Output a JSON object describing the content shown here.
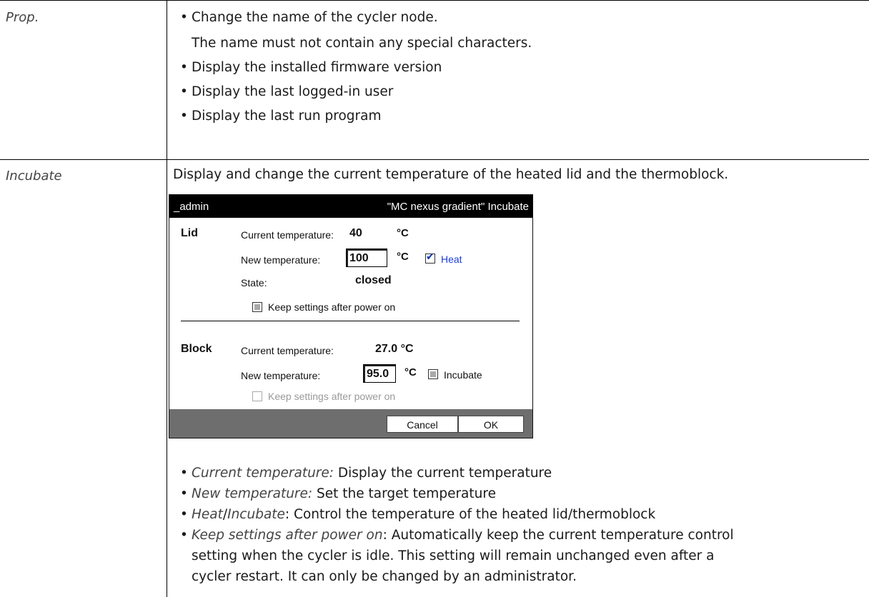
{
  "rows": [
    {
      "label": "Prop.",
      "bullets": [
        {
          "text": "Change the name of the cycler node.",
          "sub": "The name must not contain any special characters."
        },
        {
          "text": "Display the installed firmware version"
        },
        {
          "text": "Display the last logged-in user"
        },
        {
          "text": "Display the last run program"
        }
      ]
    },
    {
      "label": "Incubate",
      "intro": "Display and change the current temperature of the heated lid and the thermoblock."
    }
  ],
  "dialog": {
    "title_left": "_admin",
    "title_right": "\"MC nexus gradient\" Incubate",
    "lid": {
      "title": "Lid",
      "current_label": "Current temperature:",
      "current_value": "40",
      "unit": "°C",
      "new_label": "New temperature:",
      "new_value": "100",
      "heat_label": "Heat",
      "heat_checked": true,
      "state_label": "State:",
      "state_value": "closed",
      "keep_label": "Keep settings after power on",
      "keep_checked": false
    },
    "block": {
      "title": "Block",
      "current_label": "Current temperature:",
      "current_value": "27.0 °C",
      "new_label": "New temperature:",
      "new_value": "95.0",
      "unit": "°C",
      "incubate_label": "Incubate",
      "incubate_checked": false,
      "keep_label": "Keep settings after power on",
      "keep_disabled": true
    },
    "buttons": {
      "cancel": "Cancel",
      "ok": "OK"
    }
  },
  "notes": [
    {
      "term": "Current temperature:",
      "desc": " Display the current temperature"
    },
    {
      "term": "New temperature:",
      "desc": " Set the target temperature"
    },
    {
      "term": "Heat",
      "mid": "/",
      "term2": "Incubate",
      "desc": ": Control the temperature of the heated lid/thermoblock"
    },
    {
      "term": "Keep settings after power on",
      "desc": ": Automatically keep the current temperature control",
      "line2": "setting when the cycler is idle. This setting will remain unchanged even after a",
      "line3": "cycler restart. It can only be changed by an administrator."
    }
  ]
}
